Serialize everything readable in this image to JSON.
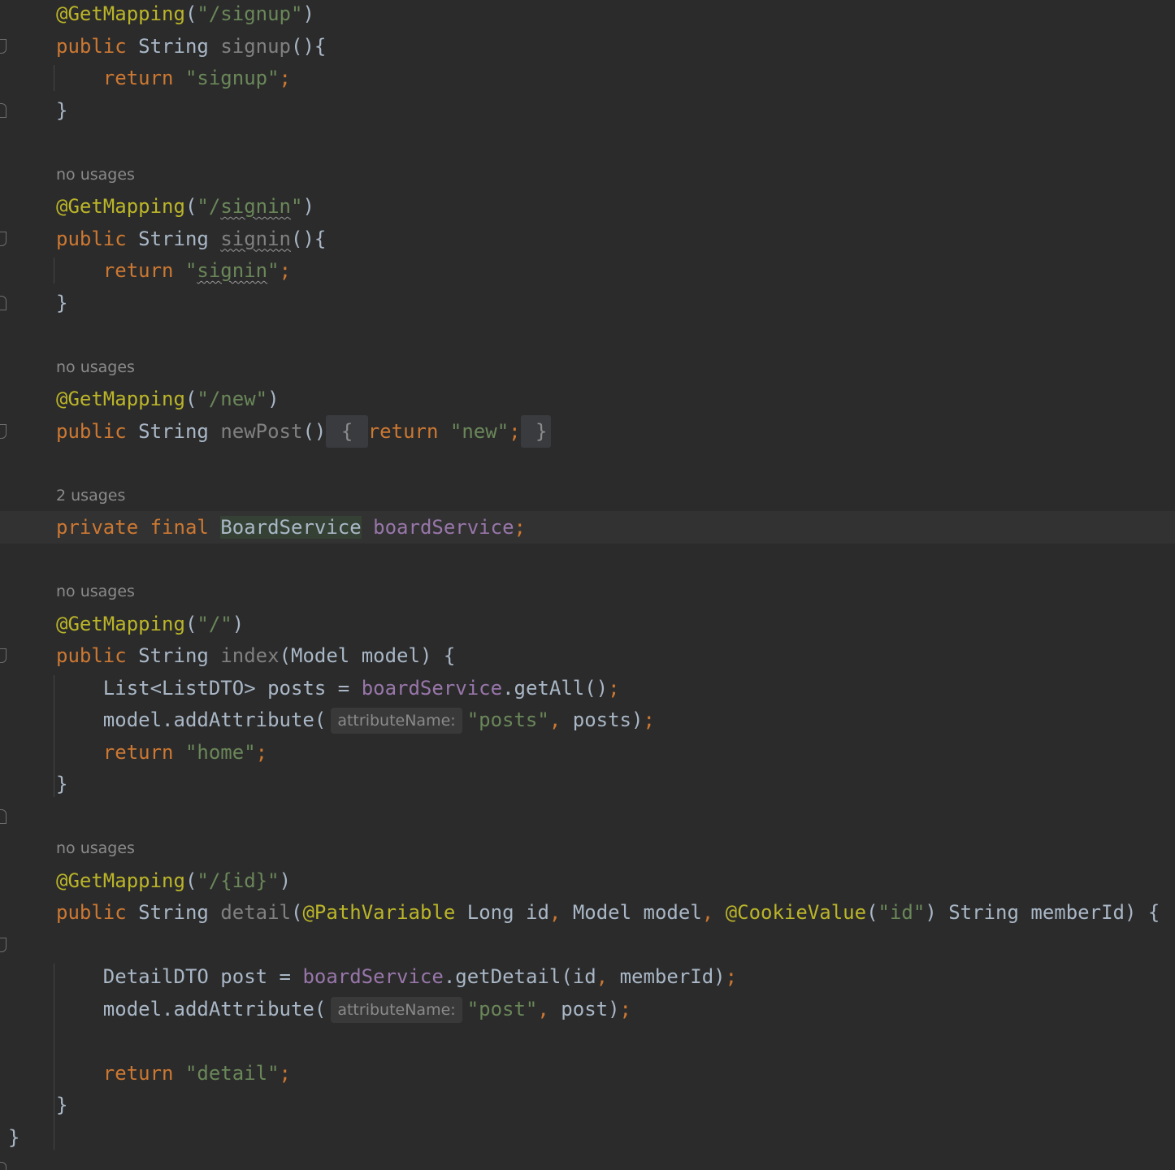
{
  "editor": {
    "language": "java",
    "lines": [
      {
        "type": "code",
        "current": false,
        "tokens": [
          {
            "t": "@GetMapping",
            "c": "ann"
          },
          {
            "t": "(",
            "c": "plain"
          },
          {
            "t": "\"/signup\"",
            "c": "str"
          },
          {
            "t": ")",
            "c": "plain"
          }
        ]
      },
      {
        "type": "code",
        "current": false,
        "tokens": [
          {
            "t": "public ",
            "c": "kw"
          },
          {
            "t": "String ",
            "c": "plain"
          },
          {
            "t": "signup",
            "c": "dim"
          },
          {
            "t": "(){",
            "c": "plain"
          }
        ]
      },
      {
        "type": "code",
        "current": false,
        "tokens": [
          {
            "t": "    "
          },
          {
            "t": "return ",
            "c": "kw"
          },
          {
            "t": "\"signup\"",
            "c": "str"
          },
          {
            "t": ";",
            "c": "kw"
          }
        ]
      },
      {
        "type": "code",
        "current": false,
        "tokens": [
          {
            "t": "}",
            "c": "plain"
          }
        ]
      },
      {
        "type": "blank"
      },
      {
        "type": "usage",
        "text": "no usages"
      },
      {
        "type": "code",
        "current": false,
        "tokens": [
          {
            "t": "@GetMapping",
            "c": "ann"
          },
          {
            "t": "(",
            "c": "plain"
          },
          {
            "t": "\"/",
            "c": "str"
          },
          {
            "t": "signin",
            "c": "str",
            "squig": true
          },
          {
            "t": "\"",
            "c": "str"
          },
          {
            "t": ")",
            "c": "plain"
          }
        ]
      },
      {
        "type": "code",
        "current": false,
        "tokens": [
          {
            "t": "public ",
            "c": "kw"
          },
          {
            "t": "String ",
            "c": "plain"
          },
          {
            "t": "signin",
            "c": "dim",
            "squig": true
          },
          {
            "t": "(){",
            "c": "plain"
          }
        ]
      },
      {
        "type": "code",
        "current": false,
        "tokens": [
          {
            "t": "    "
          },
          {
            "t": "return ",
            "c": "kw"
          },
          {
            "t": "\"",
            "c": "str"
          },
          {
            "t": "signin",
            "c": "str",
            "squig": true
          },
          {
            "t": "\"",
            "c": "str"
          },
          {
            "t": ";",
            "c": "kw"
          }
        ]
      },
      {
        "type": "code",
        "current": false,
        "tokens": [
          {
            "t": "}",
            "c": "plain"
          }
        ]
      },
      {
        "type": "blank"
      },
      {
        "type": "usage",
        "text": "no usages"
      },
      {
        "type": "code",
        "current": false,
        "tokens": [
          {
            "t": "@GetMapping",
            "c": "ann"
          },
          {
            "t": "(",
            "c": "plain"
          },
          {
            "t": "\"/new\"",
            "c": "str"
          },
          {
            "t": ")",
            "c": "plain"
          }
        ]
      },
      {
        "type": "code",
        "current": false,
        "tokens": [
          {
            "t": "public ",
            "c": "kw"
          },
          {
            "t": "String ",
            "c": "plain"
          },
          {
            "t": "newPost",
            "c": "dim"
          },
          {
            "t": "()",
            "c": "plain"
          },
          {
            "t": " { ",
            "c": "fold"
          },
          {
            "t": "return ",
            "c": "kw"
          },
          {
            "t": "\"new\"",
            "c": "str"
          },
          {
            "t": ";",
            "c": "kw"
          },
          {
            "t": " }",
            "c": "fold"
          }
        ]
      },
      {
        "type": "blank"
      },
      {
        "type": "usage",
        "text": "2 usages"
      },
      {
        "type": "code",
        "current": true,
        "tokens": [
          {
            "t": "private ",
            "c": "kw"
          },
          {
            "t": "final ",
            "c": "kw"
          },
          {
            "t": "BoardService",
            "c": "plain",
            "hl": true
          },
          {
            "t": " "
          },
          {
            "t": "boardService",
            "c": "fld"
          },
          {
            "t": ";",
            "c": "kw"
          }
        ]
      },
      {
        "type": "blank"
      },
      {
        "type": "usage",
        "text": "no usages"
      },
      {
        "type": "code",
        "current": false,
        "tokens": [
          {
            "t": "@GetMapping",
            "c": "ann"
          },
          {
            "t": "(",
            "c": "plain"
          },
          {
            "t": "\"/\"",
            "c": "str"
          },
          {
            "t": ")",
            "c": "plain"
          }
        ]
      },
      {
        "type": "code",
        "current": false,
        "tokens": [
          {
            "t": "public ",
            "c": "kw"
          },
          {
            "t": "String ",
            "c": "plain"
          },
          {
            "t": "index",
            "c": "dim"
          },
          {
            "t": "(Model model) {",
            "c": "plain"
          }
        ]
      },
      {
        "type": "code",
        "current": false,
        "tokens": [
          {
            "t": "    "
          },
          {
            "t": "List<ListDTO> posts = ",
            "c": "plain"
          },
          {
            "t": "boardService",
            "c": "fld"
          },
          {
            "t": ".getAll()",
            "c": "plain"
          },
          {
            "t": ";",
            "c": "kw"
          }
        ]
      },
      {
        "type": "code",
        "current": false,
        "tokens": [
          {
            "t": "    "
          },
          {
            "t": "model.addAttribute(",
            "c": "plain"
          },
          {
            "hint": "attributeName:"
          },
          {
            "t": "\"posts\"",
            "c": "str"
          },
          {
            "t": ", ",
            "c": "kw"
          },
          {
            "t": "posts)",
            "c": "plain"
          },
          {
            "t": ";",
            "c": "kw"
          }
        ]
      },
      {
        "type": "code",
        "current": false,
        "tokens": [
          {
            "t": "    "
          },
          {
            "t": "return ",
            "c": "kw"
          },
          {
            "t": "\"home\"",
            "c": "str"
          },
          {
            "t": ";",
            "c": "kw"
          }
        ]
      },
      {
        "type": "code",
        "current": false,
        "tokens": [
          {
            "t": "}",
            "c": "plain"
          }
        ]
      },
      {
        "type": "blank"
      },
      {
        "type": "usage",
        "text": "no usages"
      },
      {
        "type": "code",
        "current": false,
        "tokens": [
          {
            "t": "@GetMapping",
            "c": "ann"
          },
          {
            "t": "(",
            "c": "plain"
          },
          {
            "t": "\"/{id}\"",
            "c": "str"
          },
          {
            "t": ")",
            "c": "plain"
          }
        ]
      },
      {
        "type": "code",
        "current": false,
        "tokens": [
          {
            "t": "public ",
            "c": "kw"
          },
          {
            "t": "String ",
            "c": "plain"
          },
          {
            "t": "detail",
            "c": "dim"
          },
          {
            "t": "(",
            "c": "plain"
          },
          {
            "t": "@PathVariable ",
            "c": "ann"
          },
          {
            "t": "Long id",
            "c": "plain"
          },
          {
            "t": ", ",
            "c": "kw"
          },
          {
            "t": "Model model",
            "c": "plain"
          },
          {
            "t": ", ",
            "c": "kw"
          },
          {
            "t": "@CookieValue",
            "c": "ann"
          },
          {
            "t": "(",
            "c": "plain"
          },
          {
            "t": "\"id\"",
            "c": "str"
          },
          {
            "t": ") String memberId) {",
            "c": "plain"
          }
        ]
      },
      {
        "type": "blank"
      },
      {
        "type": "code",
        "current": false,
        "tokens": [
          {
            "t": "    "
          },
          {
            "t": "DetailDTO post = ",
            "c": "plain"
          },
          {
            "t": "boardService",
            "c": "fld"
          },
          {
            "t": ".getDetail(id",
            "c": "plain"
          },
          {
            "t": ", ",
            "c": "kw"
          },
          {
            "t": "memberId)",
            "c": "plain"
          },
          {
            "t": ";",
            "c": "kw"
          }
        ]
      },
      {
        "type": "code",
        "current": false,
        "tokens": [
          {
            "t": "    "
          },
          {
            "t": "model.addAttribute(",
            "c": "plain"
          },
          {
            "hint": "attributeName:"
          },
          {
            "t": "\"post\"",
            "c": "str"
          },
          {
            "t": ", ",
            "c": "kw"
          },
          {
            "t": "post)",
            "c": "plain"
          },
          {
            "t": ";",
            "c": "kw"
          }
        ]
      },
      {
        "type": "blank"
      },
      {
        "type": "code",
        "current": false,
        "tokens": [
          {
            "t": "    "
          },
          {
            "t": "return ",
            "c": "kw"
          },
          {
            "t": "\"detail\"",
            "c": "str"
          },
          {
            "t": ";",
            "c": "kw"
          }
        ]
      },
      {
        "type": "code",
        "current": false,
        "tokens": [
          {
            "t": "}",
            "c": "plain"
          }
        ]
      },
      {
        "type": "code",
        "outer": true,
        "current": false,
        "tokens": [
          {
            "t": "}",
            "c": "plain"
          }
        ]
      }
    ]
  }
}
